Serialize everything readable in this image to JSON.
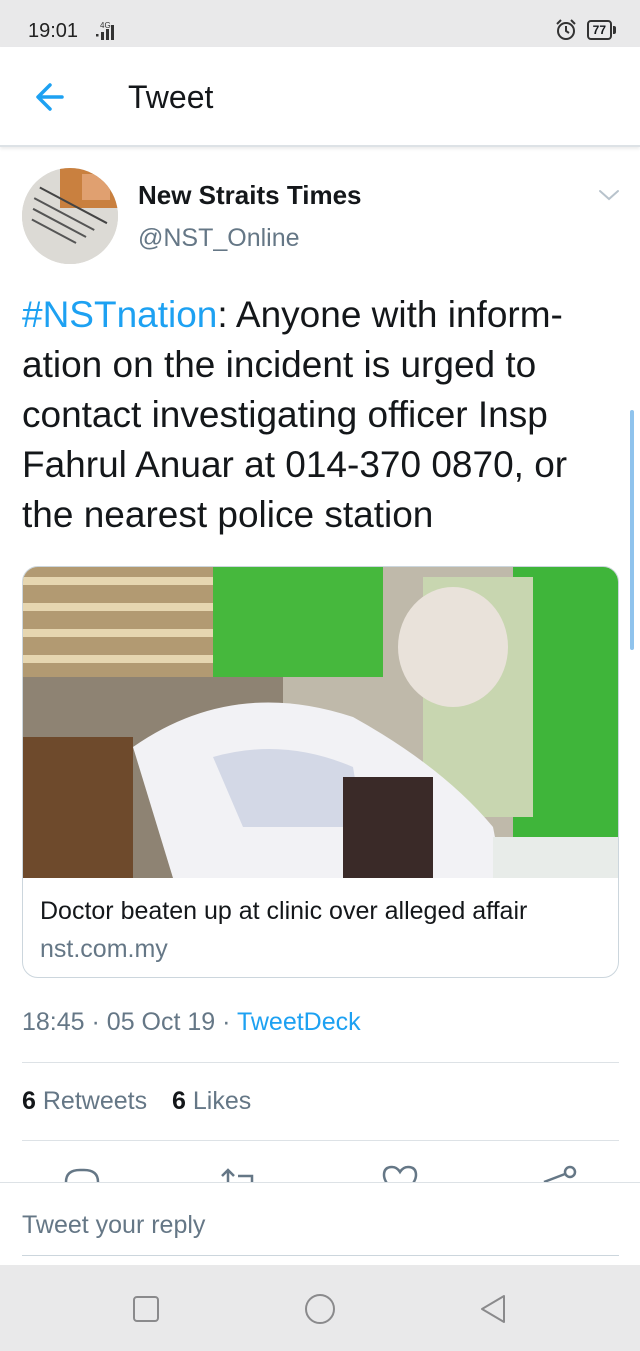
{
  "status_bar": {
    "time": "19:01",
    "network": "4G",
    "battery": "77",
    "icons": [
      "signal-icon",
      "alarm-icon",
      "battery-icon"
    ]
  },
  "header": {
    "title": "Tweet",
    "back_icon": "arrow-left-icon"
  },
  "tweet": {
    "author_name": "New Straits Times",
    "handle": "@NST_Online",
    "hashtag": "#NSTnation",
    "body": ": Anyone with inform- ation on the incident is urged to contact investigating officer Insp Fahrul Anuar at 014-370 0870, or the nearest police station",
    "card": {
      "title": "Doctor beaten up at clinic over alleged affair",
      "domain": "nst.com.my"
    },
    "time": "18:45",
    "date": "05 Oct 19",
    "source": "TweetDeck",
    "retweets_count": "6",
    "retweets_label": "Retweets",
    "likes_count": "6",
    "likes_label": "Likes"
  },
  "actions": [
    "reply-icon",
    "retweet-icon",
    "like-icon",
    "share-icon"
  ],
  "reply": {
    "placeholder": "Tweet your reply"
  },
  "nav": [
    "recents-icon",
    "home-icon",
    "back-icon"
  ],
  "colors": {
    "accent": "#1da1f2",
    "secondary_text": "#657786",
    "primary_text": "#14171a",
    "divider": "#dde2e6",
    "system_bar": "#e9e9ea"
  }
}
